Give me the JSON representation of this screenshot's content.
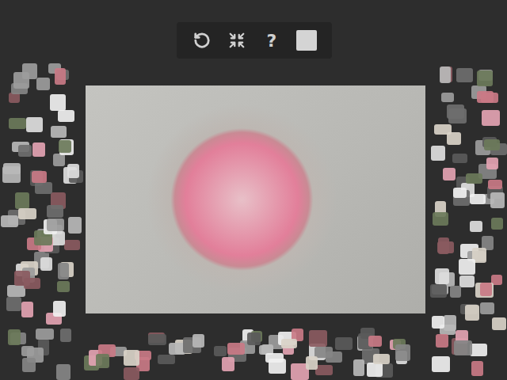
{
  "toolbar": {
    "buttons": [
      {
        "kind": "undo"
      },
      {
        "kind": "scatter"
      },
      {
        "kind": "help",
        "label": "?"
      },
      {
        "kind": "preview"
      }
    ]
  }
}
